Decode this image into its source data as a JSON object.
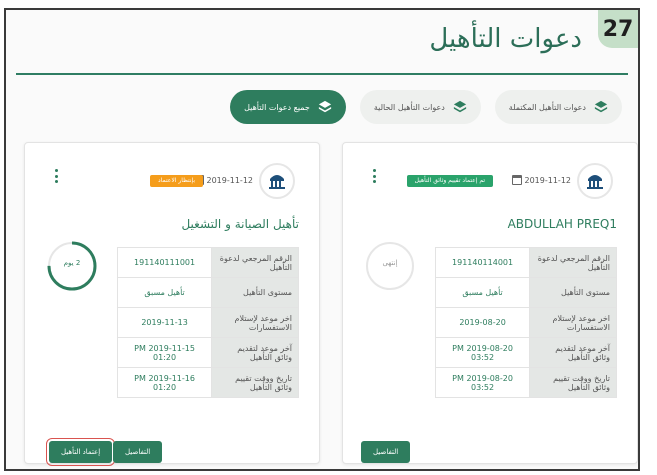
{
  "step_number": "27",
  "page_title": "دعوات التأهيل",
  "tabs": [
    {
      "label": "جميع دعوات التأهيل",
      "active": true,
      "icon": "layers-icon"
    },
    {
      "label": "دعوات التأهيل الحالية",
      "active": false,
      "icon": "layers-icon"
    },
    {
      "label": "دعوات التأهيل المكتملة",
      "active": false,
      "icon": "layers-icon"
    }
  ],
  "cards": [
    {
      "title": "ABDULLAH PREQ1",
      "date": "2019-11-12",
      "status": "تم إعتماد تقييم وثائق التأهيل",
      "status_color": "#2aa36b",
      "progress_label": "إنتهى",
      "progress": 0,
      "rows": [
        {
          "label": "الرقم المرجعي لدعوة التأهيل",
          "value": "191140114001"
        },
        {
          "label": "مستوى التأهيل",
          "value": "تأهيل مسبق"
        },
        {
          "label": "اخر موعد لإستلام الاستفسارات",
          "value": "2019-08-20"
        },
        {
          "label": "آخر موعد لتقديم وثائق التأهيل",
          "value": "2019-08-20 PM 03:52"
        },
        {
          "label": "تاريخ ووقت تقييم وثائق التأهيل",
          "value": "2019-08-20 PM 03:52"
        }
      ],
      "buttons": {
        "details": "التفاصيل"
      }
    },
    {
      "title": "تأهيل الصيانة و التشغيل",
      "date": "2019-11-12",
      "status": "بإنتظار الاعتماد",
      "status_color": "#f59d1b",
      "progress_label": "2 يوم",
      "progress": 0.75,
      "rows": [
        {
          "label": "الرقم المرجعي لدعوة التأهيل",
          "value": "191140111001"
        },
        {
          "label": "مستوى التأهيل",
          "value": "تأهيل مسبق"
        },
        {
          "label": "اخر موعد لإستلام الاستفسارات",
          "value": "2019-11-13"
        },
        {
          "label": "آخر موعد لتقديم وثائق التأهيل",
          "value": "2019-11-15 PM 01:20"
        },
        {
          "label": "تاريخ ووقت تقييم وثائق التأهيل",
          "value": "2019-11-16 PM 01:20"
        }
      ],
      "buttons": {
        "details": "التفاصيل",
        "approve": "إعتماد التأهيل"
      }
    }
  ],
  "colors": {
    "primary": "#2e7d5e",
    "title": "#2c6e58"
  }
}
